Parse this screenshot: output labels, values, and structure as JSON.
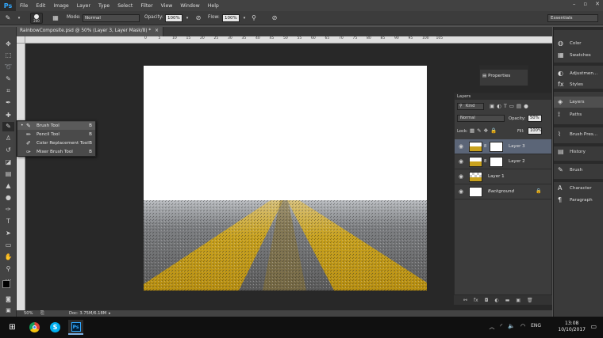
{
  "app": {
    "logo": "Ps",
    "menu": [
      "File",
      "Edit",
      "Image",
      "Layer",
      "Type",
      "Select",
      "Filter",
      "View",
      "Window",
      "Help"
    ]
  },
  "options": {
    "brush_size": "200",
    "mode_label": "Mode:",
    "mode_value": "Normal",
    "opacity_label": "Opacity:",
    "opacity_value": "100%",
    "flow_label": "Flow:",
    "flow_value": "100%",
    "workspace": "Essentials"
  },
  "document": {
    "tab_title": "RainbowComposite.psd @ 50% (Layer 3, Layer Mask/8) *",
    "zoom": "50%",
    "doc_info": "Doc: 3.75M/6.18M"
  },
  "ruler_ticks": [
    "0",
    "5",
    "10",
    "15",
    "20",
    "25",
    "30",
    "35",
    "40",
    "45",
    "50",
    "55",
    "60",
    "65",
    "70",
    "75",
    "80",
    "85",
    "90",
    "95",
    "100",
    "105"
  ],
  "flyout": [
    {
      "label": "Brush Tool",
      "key": "B",
      "icon": "brush-icon",
      "selected": true
    },
    {
      "label": "Pencil Tool",
      "key": "B",
      "icon": "pencil-icon",
      "selected": false
    },
    {
      "label": "Color Replacement Tool",
      "key": "B",
      "icon": "color-replacement-icon",
      "selected": false
    },
    {
      "label": "Mixer Brush Tool",
      "key": "B",
      "icon": "mixer-brush-icon",
      "selected": false
    }
  ],
  "properties_panel": {
    "label": "Properties"
  },
  "layers_panel": {
    "title": "Layers",
    "kind_label": "Kind",
    "blend_mode": "Normal",
    "opacity_label": "Opacity:",
    "opacity_value": "50%",
    "lock_label": "Lock:",
    "fill_label": "Fill:",
    "fill_value": "100%",
    "layers": [
      {
        "name": "Layer 3",
        "selected": true,
        "mask": true
      },
      {
        "name": "Layer 2",
        "selected": false,
        "mask": true
      },
      {
        "name": "Layer 1",
        "selected": false,
        "mask": false
      },
      {
        "name": "Background",
        "selected": false,
        "mask": false,
        "locked": true
      }
    ]
  },
  "dock": {
    "items": [
      {
        "label": "Color",
        "icon": "color-icon"
      },
      {
        "label": "Swatches",
        "icon": "swatches-icon"
      },
      {
        "label": "Adjustmen...",
        "icon": "adjustments-icon"
      },
      {
        "label": "Styles",
        "icon": "styles-icon"
      },
      {
        "label": "Layers",
        "icon": "layers-icon"
      },
      {
        "label": "Paths",
        "icon": "paths-icon"
      },
      {
        "label": "Brush Pres...",
        "icon": "brush-presets-icon"
      },
      {
        "label": "History",
        "icon": "history-icon"
      },
      {
        "label": "Brush",
        "icon": "brush-panel-icon"
      },
      {
        "label": "Character",
        "icon": "character-icon"
      },
      {
        "label": "Paragraph",
        "icon": "paragraph-icon"
      }
    ]
  },
  "taskbar": {
    "time": "13:08",
    "date": "10/10/2017",
    "language": "ENG"
  },
  "colors": {
    "menubar": "#424242",
    "selected_layer": "#5b6577",
    "road_yellow": "#c9a21e",
    "ps_blue": "#31a8ff"
  }
}
